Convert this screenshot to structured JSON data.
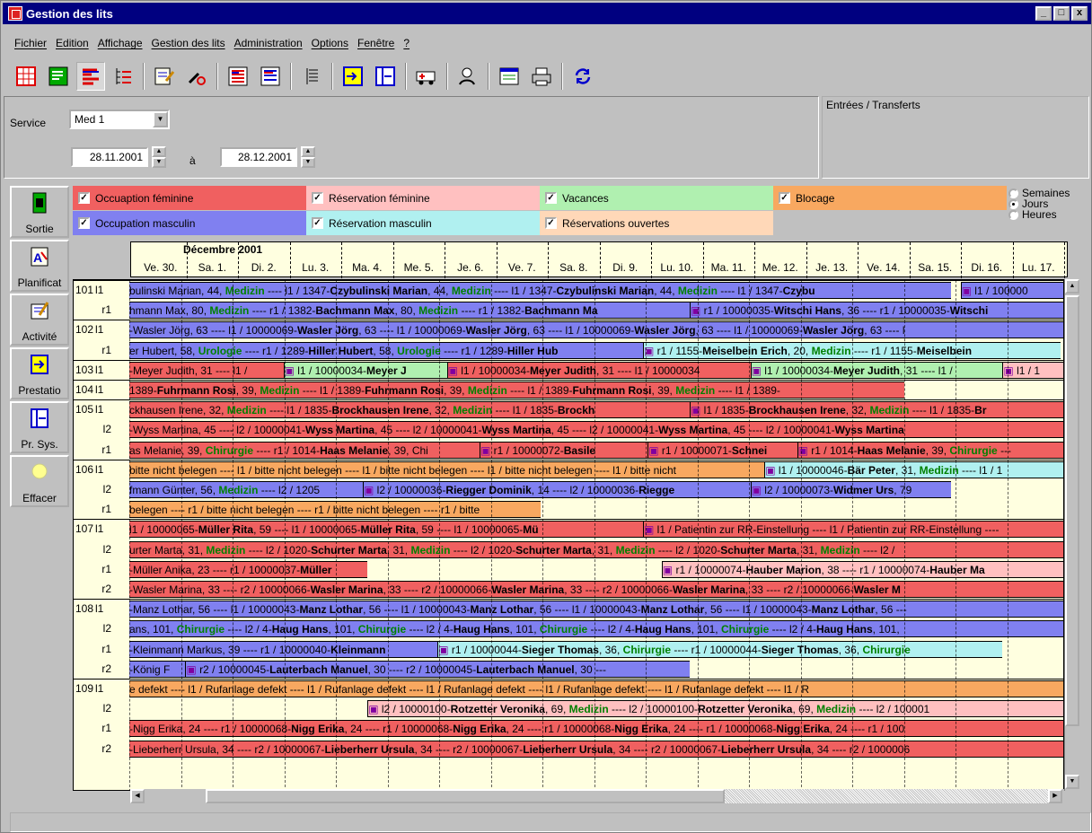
{
  "window": {
    "title": "Gestion des lits",
    "controls": [
      "_",
      "□",
      "x"
    ]
  },
  "menu": [
    "Fichier",
    "Edition",
    "Affichage",
    "Gestion des lits",
    "Administration",
    "Options",
    "Fenêtre",
    "?"
  ],
  "toolbar_icons": [
    "calendar-grid-icon",
    "list-icon",
    "bed-chart-icon",
    "tree-list-icon",
    "report-icon",
    "tools-icon",
    "month-view-icon",
    "week-view-icon",
    "list-detail-icon",
    "transfer-in-icon",
    "transfer-out-icon",
    "ambulance-icon",
    "person-search-icon",
    "document-icon",
    "print-icon",
    "refresh-icon"
  ],
  "filter": {
    "service_label": "Service",
    "service_value": "Med 1",
    "date_from": "28.11.2001",
    "date_to": "28.12.2001",
    "to_label": "à"
  },
  "entries_title": "Entrées / Transferts",
  "left_buttons": [
    "Sortie",
    "Planificat",
    "Activité",
    "Prestatio",
    "Pr. Sys.",
    "Effacer"
  ],
  "legend": [
    {
      "label": "Occuaption féminine",
      "color": "#f06060"
    },
    {
      "label": "Réservation féminine",
      "color": "#ffc0c0"
    },
    {
      "label": "Vacances",
      "color": "#b0f0b0"
    },
    {
      "label": "Blocage",
      "color": "#f8a860"
    },
    {
      "label": "Occupation masculin",
      "color": "#8080f0"
    },
    {
      "label": "Réservation masculin",
      "color": "#b0f0f0"
    },
    {
      "label": "Réservations ouvertes",
      "color": "#ffd8b8"
    }
  ],
  "view_modes": [
    {
      "label": "Semaines",
      "selected": false
    },
    {
      "label": "Jours",
      "selected": true
    },
    {
      "label": "Heures",
      "selected": false
    }
  ],
  "calendar": {
    "month": "Décembre 2001",
    "days": [
      "Ve. 30.",
      "Sa. 1.",
      "Di. 2.",
      "Lu. 3.",
      "Ma. 4.",
      "Me. 5.",
      "Je. 6.",
      "Ve. 7.",
      "Sa. 8.",
      "Di. 9.",
      "Lu. 10.",
      "Ma. 11.",
      "Me. 12.",
      "Je. 13.",
      "Ve. 14.",
      "Sa. 15.",
      "Di. 16.",
      "Lu. 17."
    ]
  },
  "rows": [
    {
      "room": "101",
      "bed": "l1",
      "bars": [
        {
          "text": "bulinski Marian, 44, Medizin ---- l1 / 1347-Czybulinski Marian, 44, Medizin ---- l1 / 1347-Czybulinski Marian, 44, Medizin ---- l1 / 1347-Czybu",
          "color": "#8080f0"
        },
        {
          "text": "l1 / 100000",
          "color": "#8080f0"
        }
      ]
    },
    {
      "room": "",
      "bed": "r1",
      "bars": [
        {
          "text": "hmann Max, 80, Medizin ---- r1 / 1382-Bachmann Max, 80, Medizin ---- r1 / 1382-Bachmann Ma",
          "color": "#8080f0"
        },
        {
          "text": "r1 / 10000035-Witschi Hans, 36 ---- r1 / 10000035-Witschi",
          "color": "#8080f0"
        }
      ]
    },
    {
      "room": "102",
      "bed": "l1",
      "bars": [
        {
          "text": "-Wasler Jörg, 63 ---- l1 / 10000069-Wasler Jörg, 63 ---- l1 / 10000069-Wasler Jörg, 63 ---- l1 / 10000069-Wasler Jörg, 63 ---- l1 / 10000069-Wasler Jörg, 63 ---- l",
          "color": "#8080f0"
        }
      ]
    },
    {
      "room": "",
      "bed": "r1",
      "bars": [
        {
          "text": "er Hubert, 58, Urologie ---- r1 / 1289-Hiller Hubert, 58, Urologie ---- r1 / 1289-Hiller Hub",
          "color": "#8080f0"
        },
        {
          "text": "r1 / 1155-Meiselbein Erich, 20, Medizin ---- r1 / 1155-Meiselbein",
          "color": "#b0f0f0"
        }
      ]
    },
    {
      "room": "103",
      "bed": "l1",
      "bars": [
        {
          "text": "-Meyer Judith, 31 ---- l1 /",
          "color": "#f06060"
        },
        {
          "text": "l1 / 10000034-Meyer J",
          "color": "#b0f0b0"
        },
        {
          "text": "l1 / 10000034-Meyer Judith, 31 ---- l1 / 10000034",
          "color": "#f06060"
        },
        {
          "text": "l1 / 10000034-Meyer Judith, 31 ---- l1 /",
          "color": "#b0f0b0"
        },
        {
          "text": "l1 / 1",
          "color": "#ffc0c0"
        }
      ]
    },
    {
      "room": "104",
      "bed": "l1",
      "bars": [
        {
          "text": "1389-Fuhrmann Rosi, 39, Medizin ---- l1 / 1389-Fuhrmann Rosi, 39, Medizin ---- l1 / 1389-Fuhrmann Rosi, 39, Medizin ---- l1 / 1389-",
          "color": "#f06060"
        }
      ]
    },
    {
      "room": "105",
      "bed": "l1",
      "bars": [
        {
          "text": "ckhausen Irene, 32, Medizin ---- l1 / 1835-Brockhausen Irene, 32, Medizin ---- l1 / 1835-Brockh",
          "color": "#f06060"
        },
        {
          "text": "l1 / 1835-Brockhausen Irene, 32, Medizin ---- l1 / 1835-Br",
          "color": "#f06060"
        }
      ]
    },
    {
      "room": "",
      "bed": "l2",
      "bars": [
        {
          "text": "-Wyss Martina, 45 ---- l2 / 10000041-Wyss Martina, 45 ---- l2 / 10000041-Wyss Martina, 45 ---- l2 / 10000041-Wyss Martina, 45 ---- l2 / 10000041-Wyss Martina",
          "color": "#f06060"
        }
      ]
    },
    {
      "room": "",
      "bed": "r1",
      "bars": [
        {
          "text": "as Melanie, 39, Chirurgie ---- r1 / 1014-Haas Melanie, 39, Chi",
          "color": "#f06060"
        },
        {
          "text": "r1 / 10000072-Basile",
          "color": "#f06060"
        },
        {
          "text": "r1 / 10000071-Schnei",
          "color": "#f06060"
        },
        {
          "text": "r1 / 1014-Haas Melanie, 39, Chirurgie ---",
          "color": "#f06060"
        }
      ]
    },
    {
      "room": "106",
      "bed": "l1",
      "bars": [
        {
          "text": "bitte nicht belegen ---- l1 / bitte nicht belegen ---- l1 / bitte nicht belegen ---- l1 / bitte nicht belegen ---- l1 / bitte nicht",
          "color": "#f8a860"
        },
        {
          "text": "l1 / 10000046-Bär Peter, 31, Medizin ---- l1 / 1",
          "color": "#b0f0f0"
        }
      ]
    },
    {
      "room": "",
      "bed": "l2",
      "bars": [
        {
          "text": "fmann Günter, 56, Medizin ---- l2 / 1205",
          "color": "#8080f0"
        },
        {
          "text": "l2 / 10000036-Riegger Dominik, 14 ---- l2 / 10000036-Riegge",
          "color": "#8080f0"
        },
        {
          "text": "l2 / 10000073-Widmer Urs, 79",
          "color": "#8080f0"
        }
      ]
    },
    {
      "room": "",
      "bed": "r1",
      "bars": [
        {
          "text": "belegen ---- r1 / bitte nicht belegen ---- r1 / bitte nicht belegen ---- r1 / bitte",
          "color": "#f8a860"
        }
      ]
    },
    {
      "room": "107",
      "bed": "l1",
      "bars": [
        {
          "text": "l1 / 10000065-Müller Rita, 59 ---- l1 / 10000065-Müller Rita, 59 ---- l1 / 10000065-Mü",
          "color": "#f06060"
        },
        {
          "text": "l1 / Patientin zur RR-Einstellung ---- l1 / Patientin zur RR-Einstellung ----",
          "color": "#f06060"
        }
      ]
    },
    {
      "room": "",
      "bed": "l2",
      "bars": [
        {
          "text": "urter Marta, 31, Medizin ---- l2 / 1020-Schurter Marta, 31, Medizin ---- l2 / 1020-Schurter Marta, 31, Medizin ---- l2 / 1020-Schurter Marta, 31, Medizin ---- l2 /",
          "color": "#f06060"
        }
      ]
    },
    {
      "room": "",
      "bed": "r1",
      "bars": [
        {
          "text": "-Müller Anika, 23 ---- r1 / 10000037-Müller",
          "color": "#f06060"
        },
        {
          "text": "r1 / 10000074-Hauber Marion, 38 ---- r1 / 10000074-Hauber Ma",
          "color": "#ffc0c0"
        }
      ]
    },
    {
      "room": "",
      "bed": "r2",
      "bars": [
        {
          "text": "-Wasler Marina, 33 ---- r2 / 10000066-Wasler Marina, 33 ---- r2 / 10000066-Wasler Marina, 33 ---- r2 / 10000066-Wasler Marina, 33 ---- r2 / 10000066-Wasler M",
          "color": "#f06060"
        }
      ]
    },
    {
      "room": "108",
      "bed": "l1",
      "bars": [
        {
          "text": "-Manz Lothar, 56 ---- l1 / 10000043-Manz Lothar, 56 ---- l1 / 10000043-Manz Lothar, 56 ---- l1 / 10000043-Manz Lothar, 56 ---- l1 / 10000043-Manz Lothar, 56 ---",
          "color": "#8080f0"
        }
      ]
    },
    {
      "room": "",
      "bed": "l2",
      "bars": [
        {
          "text": "ans, 101, Chirurgie ---- l2 / 4-Haug Hans, 101, Chirurgie ---- l2 / 4-Haug Hans, 101, Chirurgie ---- l2 / 4-Haug Hans, 101, Chirurgie ---- l2 / 4-Haug Hans, 101,",
          "color": "#8080f0"
        }
      ]
    },
    {
      "room": "",
      "bed": "r1",
      "bars": [
        {
          "text": "-Kleinmann Markus, 39 ---- r1 / 10000040-Kleinmann",
          "color": "#8080f0"
        },
        {
          "text": "r1 / 10000044-Sieger Thomas, 36, Chirurgie ---- r1 / 10000044-Sieger Thomas, 36, Chirurgie",
          "color": "#b0f0f0"
        }
      ]
    },
    {
      "room": "",
      "bed": "r2",
      "bars": [
        {
          "text": "-König F",
          "color": "#8080f0"
        },
        {
          "text": "r2 / 10000045-Lauterbach Manuel, 30 ---- r2 / 10000045-Lauterbach Manuel, 30 ---",
          "color": "#8080f0"
        }
      ]
    },
    {
      "room": "109",
      "bed": "l1",
      "bars": [
        {
          "text": "e defekt ---- l1 / Rufanlage defekt ---- l1 / Rufanlage defekt ---- l1 / Rufanlage defekt ---- l1 / Rufanlage defekt ---- l1 / Rufanlage defekt ---- l1 / R",
          "color": "#f8a860"
        }
      ]
    },
    {
      "room": "",
      "bed": "l2",
      "bars": [
        {
          "text": "l2 / 10000100-Rotzetter Veronika, 69, Medizin ---- l2 / 10000100-Rotzetter Veronika, 69, Medizin ---- l2 / 100001",
          "color": "#ffc0c0"
        }
      ]
    },
    {
      "room": "",
      "bed": "r1",
      "bars": [
        {
          "text": "-Nigg Erika, 24 ---- r1 / 10000068-Nigg Erika, 24 ---- r1 / 10000068-Nigg Erika, 24 ---- r1 / 10000068-Nigg Erika, 24 ---- r1 / 10000068-Nigg Erika, 24 ---- r1 / 100",
          "color": "#f06060"
        }
      ]
    },
    {
      "room": "",
      "bed": "r2",
      "bars": [
        {
          "text": "-Lieberherr Ursula, 34 ---- r2 / 10000067-Lieberherr Ursula, 34 ---- r2 / 10000067-Lieberherr Ursula, 34 ---- r2 / 10000067-Lieberherr Ursula, 34 ---- r2 / 1000006",
          "color": "#f06060"
        }
      ]
    }
  ]
}
